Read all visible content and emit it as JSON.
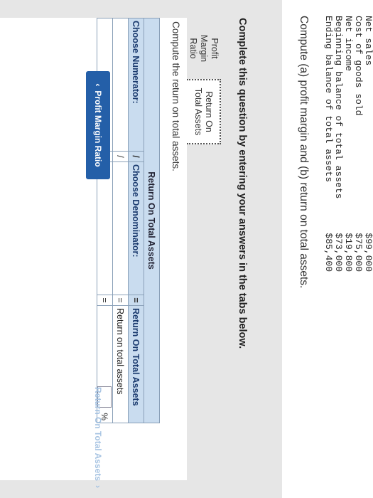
{
  "data_table": [
    {
      "label": "Net sales",
      "value": "$99,000"
    },
    {
      "label": "Cost of goods sold",
      "value": "$75,000"
    },
    {
      "label": "Net income",
      "value": "$19,800"
    },
    {
      "label": "Beginning balance of total assets",
      "value": "$73,000"
    },
    {
      "label": "Ending balance of total assets",
      "value": "$85,400"
    }
  ],
  "question": "Compute (a) profit margin and (b) return on total assets.",
  "instruction": "Complete this question by entering your answers in the tabs below.",
  "tabs": [
    {
      "label_line1": "Profit Margin",
      "label_line2": "Ratio"
    },
    {
      "label_line1": "Return On",
      "label_line2": "Total Assets"
    }
  ],
  "active_tab": 1,
  "content": {
    "compute_text": "Compute the return on total assets.",
    "table": {
      "title": "Return On Total Assets",
      "numerator_label": "Choose Numerator:",
      "div_symbol": "/",
      "denominator_label": "Choose Denominator:",
      "eq_symbol": "=",
      "result_header": "Return On Total Assets",
      "result_label": "Return on total assets",
      "percent_symbol": "%"
    }
  },
  "nav": {
    "prev_label": "Profit Margin Ratio",
    "prev_icon": "chevron-left-icon",
    "next_label": "Return On Total Assets",
    "next_icon": "chevron-right-icon"
  },
  "colors": {
    "nav_button": "#245fa8",
    "table_header": "#c9dcef",
    "panel": "#e6e6e6"
  }
}
